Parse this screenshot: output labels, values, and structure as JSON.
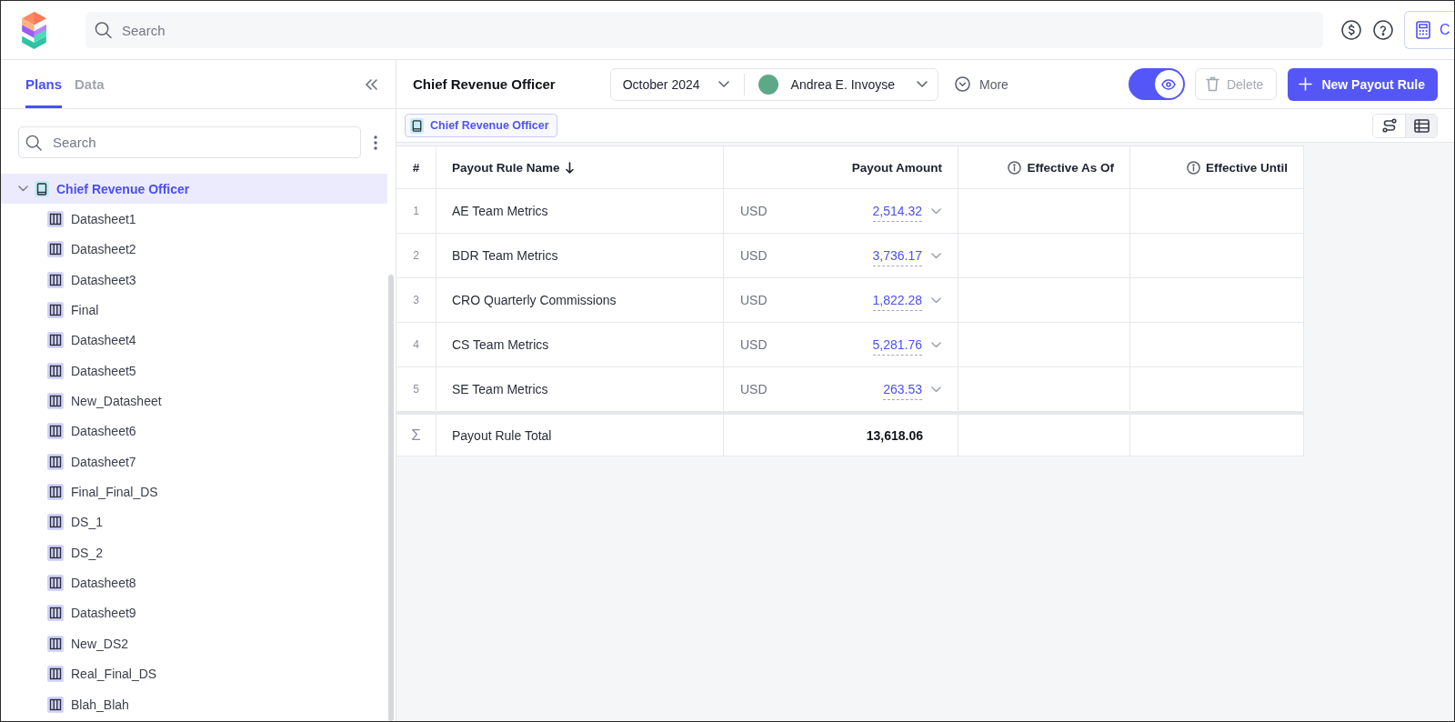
{
  "top_bar": {
    "search": {
      "placeholder": "Search"
    },
    "calculator_button": {
      "label": "C"
    }
  },
  "sidebar": {
    "tabs": [
      {
        "label": "Plans",
        "selected": true
      },
      {
        "label": "Data",
        "selected": false
      }
    ],
    "search": {
      "placeholder": "Search"
    },
    "tree": [
      {
        "kind": "plan",
        "label": "Chief Revenue Officer",
        "expanded": true,
        "selected": true,
        "children": [
          {
            "kind": "datasheet",
            "label": "Datasheet1",
            "selected": false
          },
          {
            "kind": "datasheet",
            "label": "Datasheet2",
            "selected": false
          },
          {
            "kind": "datasheet",
            "label": "Datasheet3",
            "selected": false
          },
          {
            "kind": "datasheet",
            "label": "Final",
            "selected": false
          },
          {
            "kind": "datasheet",
            "label": "Datasheet4",
            "selected": false
          },
          {
            "kind": "datasheet",
            "label": "Datasheet5",
            "selected": false
          },
          {
            "kind": "datasheet",
            "label": "New_Datasheet",
            "selected": false
          },
          {
            "kind": "datasheet",
            "label": "Datasheet6",
            "selected": false
          },
          {
            "kind": "datasheet",
            "label": "Datasheet7",
            "selected": false
          },
          {
            "kind": "datasheet",
            "label": "Final_Final_DS",
            "selected": false
          },
          {
            "kind": "datasheet",
            "label": "DS_1",
            "selected": false
          },
          {
            "kind": "datasheet",
            "label": "DS_2",
            "selected": false
          },
          {
            "kind": "datasheet",
            "label": "Datasheet8",
            "selected": false
          },
          {
            "kind": "datasheet",
            "label": "Datasheet9",
            "selected": false
          },
          {
            "kind": "datasheet",
            "label": "New_DS2",
            "selected": false
          },
          {
            "kind": "datasheet",
            "label": "Real_Final_DS",
            "selected": false
          },
          {
            "kind": "datasheet",
            "label": "Blah_Blah",
            "selected": false
          }
        ]
      }
    ]
  },
  "header": {
    "title": "Chief Revenue Officer",
    "period": "October 2024",
    "payee": "Andrea E. Invoyse",
    "more": "More",
    "preview_toggle": {
      "on": true
    },
    "delete_button": {
      "label": "Delete",
      "disabled": true
    },
    "new_button": {
      "label": "New Payout Rule"
    }
  },
  "breadcrumb": {
    "label": "Chief Revenue Officer"
  },
  "view_toggle": [
    {
      "kind": "flow",
      "selected": false
    },
    {
      "kind": "table",
      "selected": true
    }
  ],
  "table": {
    "columns": [
      {
        "kind": "index",
        "label": "#",
        "sorted": false
      },
      {
        "kind": "name",
        "label": "Payout Rule Name",
        "sorted": true
      },
      {
        "kind": "amount",
        "label": "Payout Amount",
        "sorted": false
      },
      {
        "kind": "date",
        "label": "Effective As Of",
        "sorted": false
      },
      {
        "kind": "date",
        "label": "Effective Until",
        "sorted": false
      }
    ],
    "rows": [
      {
        "index": "1",
        "name": "AE Team Metrics",
        "currency": "USD",
        "amount": "2,514.32"
      },
      {
        "index": "2",
        "name": "BDR Team Metrics",
        "currency": "USD",
        "amount": "3,736.17"
      },
      {
        "index": "3",
        "name": "CRO Quarterly Commissions",
        "currency": "USD",
        "amount": "1,822.28"
      },
      {
        "index": "4",
        "name": "CS Team Metrics",
        "currency": "USD",
        "amount": "5,281.76"
      },
      {
        "index": "5",
        "name": "SE Team Metrics",
        "currency": "USD",
        "amount": "263.53"
      }
    ],
    "total": {
      "symbol": "Σ",
      "label": "Payout Rule Total",
      "amount": "13,618.06"
    }
  }
}
